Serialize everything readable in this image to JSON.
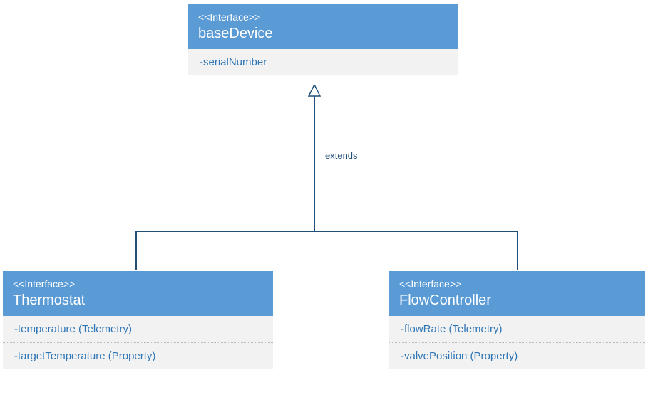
{
  "base": {
    "stereotype": "<<Interface>>",
    "name": "baseDevice",
    "attrs": [
      "-serialNumber"
    ]
  },
  "thermostat": {
    "stereotype": "<<Interface>>",
    "name": "Thermostat",
    "attrs": [
      "-temperature (Telemetry)",
      "-targetTemperature (Property)"
    ]
  },
  "flow": {
    "stereotype": "<<Interface>>",
    "name": "FlowController",
    "attrs": [
      "-flowRate (Telemetry)",
      "-valvePosition (Property)"
    ]
  },
  "relation": {
    "label": "extends"
  }
}
